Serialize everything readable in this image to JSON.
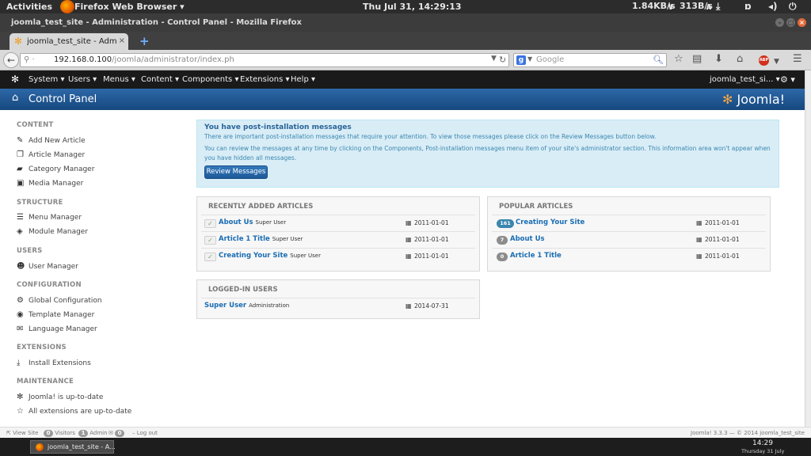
{
  "system_panel": {
    "activities": "Activities",
    "app_name": "Firefox Web Browser ▾",
    "clock": "Thu Jul 31, 14:29:13",
    "net_down": "1.84KB/s",
    "net_up": "313B/s"
  },
  "window": {
    "title": "joomla_test_site - Administration - Control Panel - Mozilla Firefox"
  },
  "tab": {
    "label": "joomla_test_site - Admi...",
    "close": "×",
    "new_tab": "+"
  },
  "nav": {
    "url_host": "192.168.0.100",
    "url_path": "/joomla/administrator/index.ph",
    "search_engine_letter": "g",
    "search_placeholder": "Google",
    "adblock_label": "ABP"
  },
  "joomla_menu": {
    "items": [
      "System ▾",
      "Users ▾",
      "Menus ▾",
      "Content ▾",
      "Components ▾",
      "Extensions ▾",
      "Help ▾"
    ],
    "site_name": "joomla_test_si... ▾",
    "settings": "⚙ ▾"
  },
  "header": {
    "title": "Control Panel",
    "brand": "Joomla!"
  },
  "sidebar": {
    "sections": [
      {
        "heading": "CONTENT",
        "links": [
          {
            "icon": "pencil-icon",
            "glyph": "✎",
            "label": "Add New Article"
          },
          {
            "icon": "article-icon",
            "glyph": "❐",
            "label": "Article Manager"
          },
          {
            "icon": "folder-icon",
            "glyph": "▰",
            "label": "Category Manager"
          },
          {
            "icon": "image-icon",
            "glyph": "▣",
            "label": "Media Manager"
          }
        ]
      },
      {
        "heading": "STRUCTURE",
        "links": [
          {
            "icon": "list-icon",
            "glyph": "☰",
            "label": "Menu Manager"
          },
          {
            "icon": "cube-icon",
            "glyph": "◈",
            "label": "Module Manager"
          }
        ]
      },
      {
        "heading": "USERS",
        "links": [
          {
            "icon": "users-icon",
            "glyph": "☻",
            "label": "User Manager"
          }
        ]
      },
      {
        "heading": "CONFIGURATION",
        "links": [
          {
            "icon": "gear-icon",
            "glyph": "⚙",
            "label": "Global Configuration"
          },
          {
            "icon": "eye-icon",
            "glyph": "◉",
            "label": "Template Manager"
          },
          {
            "icon": "comment-icon",
            "glyph": "✉",
            "label": "Language Manager"
          }
        ]
      },
      {
        "heading": "EXTENSIONS",
        "links": [
          {
            "icon": "download-icon",
            "glyph": "⤓",
            "label": "Install Extensions"
          }
        ]
      },
      {
        "heading": "MAINTENANCE",
        "links": [
          {
            "icon": "joomla-icon",
            "glyph": "✻",
            "label": "Joomla! is up-to-date"
          },
          {
            "icon": "star-icon",
            "glyph": "☆",
            "label": "All extensions are up-to-date"
          }
        ]
      }
    ]
  },
  "notice": {
    "title": "You have post-installation messages",
    "text1": "There are important post-installation messages that require your attention. To view those messages please click on the Review Messages button below.",
    "text2": "You can review the messages at any time by clicking on the Components, Post-installation messages menu item of your site's administrator section. This information area won't appear when you have hidden all messages.",
    "button": "Review Messages"
  },
  "recent_articles": {
    "heading": "RECENTLY ADDED ARTICLES",
    "rows": [
      {
        "title": "About Us",
        "author": "Super User",
        "date": "2011-01-01"
      },
      {
        "title": "Article 1 Title",
        "author": "Super User",
        "date": "2011-01-01"
      },
      {
        "title": "Creating Your Site",
        "author": "Super User",
        "date": "2011-01-01"
      }
    ]
  },
  "popular_articles": {
    "heading": "POPULAR ARTICLES",
    "rows": [
      {
        "hits": "161",
        "title": "Creating Your Site",
        "date": "2011-01-01"
      },
      {
        "hits": "7",
        "title": "About Us",
        "date": "2011-01-01"
      },
      {
        "hits": "0",
        "title": "Article 1 Title",
        "date": "2011-01-01"
      }
    ]
  },
  "logged_in": {
    "heading": "LOGGED-IN USERS",
    "rows": [
      {
        "name": "Super User",
        "role": "Administration",
        "date": "2014-07-31"
      }
    ]
  },
  "status_bar": {
    "view_site": "View Site",
    "visitors_count": "0",
    "visitors_label": "Visitors",
    "admin_count": "1",
    "admin_label": "Admin",
    "messages_count": "0",
    "logout": "Log out",
    "version": "Joomla! 3.3.3 — © 2014 joomla_test_site"
  },
  "taskbar": {
    "task_label": "joomla_test_site - A...",
    "time": "14:29",
    "date": "Thursday 31 July"
  },
  "colors": {
    "header_blue": "#1c5592",
    "link_blue": "#1a6db3",
    "notice_bg": "#d9edf7",
    "brand_orange": "#f9a541"
  }
}
